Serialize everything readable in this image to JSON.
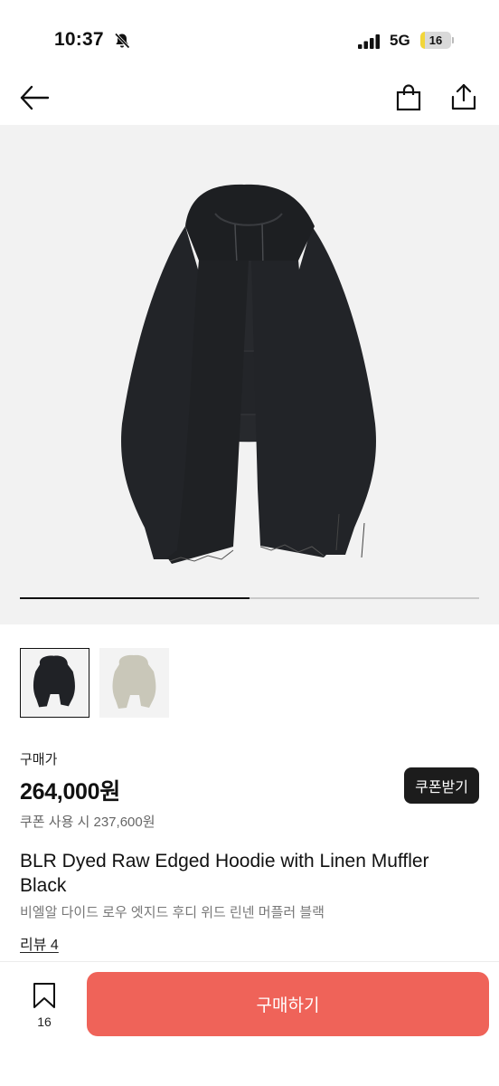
{
  "status_bar": {
    "time": "10:37",
    "network": "5G",
    "battery_level": "16",
    "battery_fraction": 0.16,
    "icons": [
      "bell-off-icon",
      "signal-icon",
      "battery-icon"
    ]
  },
  "nav": {
    "icons": [
      "back-arrow-icon",
      "shopping-bag-icon",
      "share-icon"
    ]
  },
  "gallery": {
    "image": "black hoodie with muffler",
    "progress_fraction": 0.5
  },
  "thumbnails": [
    {
      "color": "black",
      "selected": true
    },
    {
      "color": "beige",
      "selected": false
    }
  ],
  "price": {
    "label": "구매가",
    "amount": "264,000원",
    "coupon_price": "쿠폰 사용 시 237,600원",
    "coupon_button": "쿠폰받기"
  },
  "product": {
    "title": "BLR Dyed Raw Edged Hoodie with Linen Muffler Black",
    "subtitle": "비엘알 다이드 로우 엣지드 후디 위드 린넨 머플러 블랙",
    "review_link": "리뷰 4"
  },
  "bottom_bar": {
    "wishlist_count": "16",
    "buy_button": "구매하기"
  },
  "colors": {
    "accent": "#ef6359",
    "coupon_button_bg": "#1c1c1c",
    "battery_fill": "#f2d63a",
    "gallery_bg": "#f2f2f2"
  }
}
